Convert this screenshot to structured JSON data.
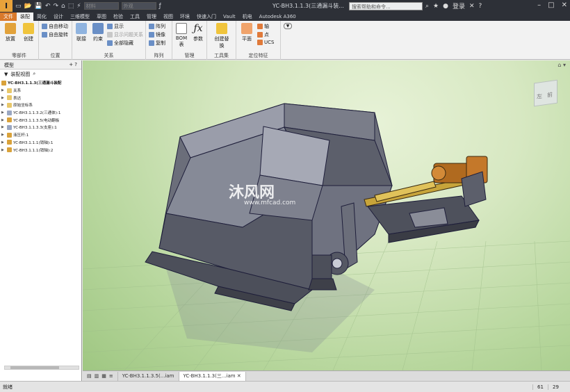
{
  "titlebar": {
    "logo": "I",
    "window_title": "YC-BH3.1.1.3(三通漏斗装...",
    "search_placeholder": "搜索帮助和命令...",
    "login": "登录",
    "qa_combo1": "材料",
    "qa_combo2": "外观"
  },
  "tabs": [
    "文件",
    "装配",
    "简化",
    "设计",
    "三维模型",
    "草图",
    "检验",
    "工具",
    "管理",
    "视图",
    "环境",
    "快速入门",
    "Vault",
    "机电",
    "Autodesk A360"
  ],
  "ribbon": {
    "components": {
      "label": "零部件",
      "place": "放置",
      "create": "创建"
    },
    "position": {
      "label": "位置",
      "free_move": "自由移动",
      "free_rotate": "自由旋转"
    },
    "relationships": {
      "label": "关系",
      "join": "联接",
      "constrain": "约束",
      "show": "显示",
      "show_problem": "显示问题关系",
      "hide_all": "全部隐藏"
    },
    "pattern": {
      "label": "阵列",
      "pattern": "阵列",
      "mirror": "镜像",
      "copy": "复制"
    },
    "manage": {
      "label": "管理",
      "bom": "BOM",
      "bom_sub": "表",
      "params": "参数"
    },
    "productivity": {
      "label": "工具集",
      "create_substitute": "创建替换"
    },
    "work_features": {
      "label": "定位特征",
      "plane": "平面",
      "axis": "轴",
      "point": "点",
      "ucs": "UCS"
    }
  },
  "browser": {
    "title": "模型",
    "view": "装配视图",
    "root": "YC-BH3.1.1.3(三通漏斗装配",
    "items": [
      "关系",
      "表达",
      "原始坐标系",
      "YC-BH3.1.1.3.2(三通体):1",
      "YC-BH3.1.1.3.5(电动翻板",
      "YC-BH3.1.1.3.3(支座):1",
      "液压杆:1",
      "YC-BH3.1.1.1(销轴):1",
      "YC-BH3.1.1.1(销轴):2"
    ]
  },
  "viewcube": {
    "front": "前",
    "left": "左"
  },
  "watermark": {
    "brand": "沐风网",
    "url": "www.mfcad.com"
  },
  "doc_tabs": [
    "YC-BH3.1.1.3.5(...iam",
    "YC-BH3.1.1.3(三...iam"
  ],
  "status": {
    "text": "就绪",
    "n1": "61",
    "n2": "29"
  },
  "colors": {
    "accent": "#d9792b",
    "titlebar": "#2d3037",
    "ribbon": "#f2f2f2"
  }
}
